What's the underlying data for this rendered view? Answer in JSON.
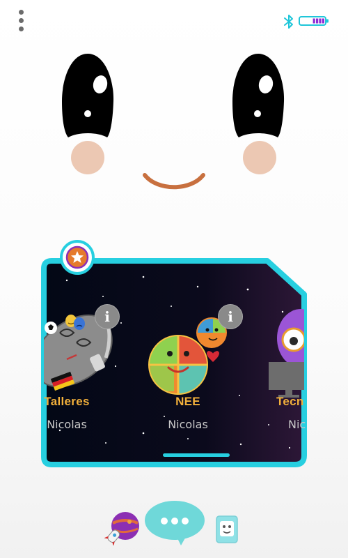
{
  "top_bar": {
    "menu_icon": "vertical-dots-icon",
    "bluetooth_icon": "bluetooth-icon",
    "battery_icon": "battery-icon",
    "battery_level": 0.45,
    "accent_color": "#1fc6d9",
    "battery_fill_color": "#8e2bd6"
  },
  "face": {
    "eye_color": "#000000",
    "blush_color": "#ecc8b3",
    "mouth_color": "#c8703f"
  },
  "card": {
    "border_color": "#27cfe0",
    "badge_icon": "star-badge-icon",
    "items": [
      {
        "title": "Talleres",
        "owner": "Nicolas",
        "icon": "astronaut-icon",
        "info_icon": "info-icon"
      },
      {
        "title": "NEE",
        "owner": "Nicolas",
        "icon": "puzzle-planet-icon",
        "info_icon": "info-icon"
      },
      {
        "title": "Tecn",
        "owner": "Nic",
        "icon": "purple-robot-icon"
      }
    ],
    "info_glyph": "i"
  },
  "bottom_nav": {
    "left_icon": "rocket-planet-icon",
    "center_icon": "chat-bubble-icon",
    "right_icon": "robot-face-icon"
  }
}
